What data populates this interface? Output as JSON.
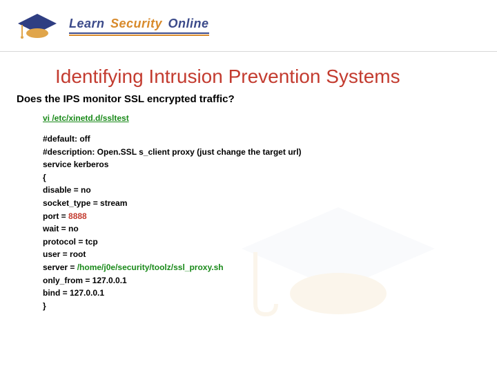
{
  "logo": {
    "learn": "Learn",
    "security": "Security",
    "online": "Online"
  },
  "title": "Identifying Intrusion Prevention Systems",
  "subtitle": "Does the IPS monitor SSL encrypted traffic?",
  "cmd": "vi /etc/xinetd.d/ssltest",
  "config": {
    "l1": "#default: off",
    "l2": "#description: Open.SSL s_client proxy (just change the target url)",
    "l3": "service kerberos",
    "l4": "{",
    "l5": "disable = no",
    "l6": "socket_type = stream",
    "l7a": "port = ",
    "l7b": "8888",
    "l8": "wait = no",
    "l9": "protocol = tcp",
    "l10": "user = root",
    "l11a": "server = ",
    "l11b": "/home/j0e/security/toolz/ssl_proxy.sh",
    "l12": "only_from = 127.0.0.1",
    "l13": "bind = 127.0.0.1",
    "l14": "}"
  }
}
